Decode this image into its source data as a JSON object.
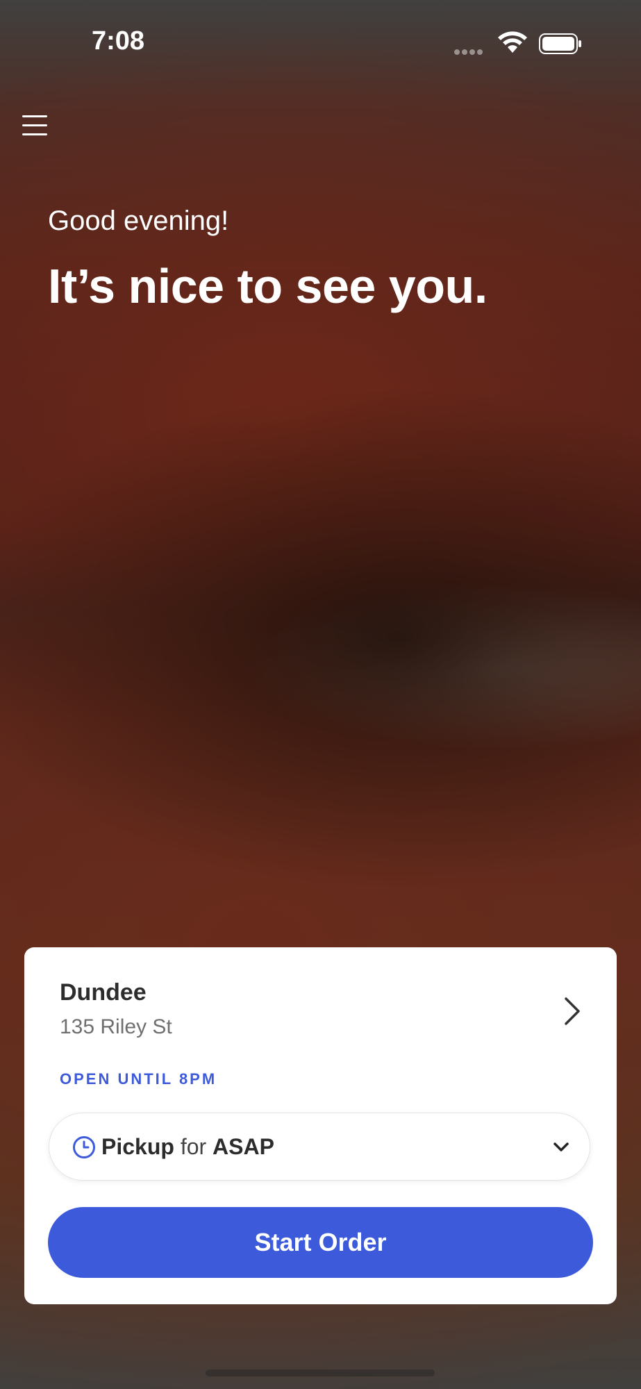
{
  "status_bar": {
    "time": "7:08"
  },
  "header": {
    "greeting": "Good evening!",
    "headline": "It’s nice to see you."
  },
  "store": {
    "name": "Dundee",
    "address": "135 Riley St",
    "hours": "OPEN UNTIL 8PM"
  },
  "order_options": {
    "mode": "Pickup",
    "connector": "for",
    "time": "ASAP"
  },
  "actions": {
    "start_order": "Start Order"
  },
  "colors": {
    "accent": "#3d5adb"
  },
  "icons": {
    "menu": "hamburger-menu-icon",
    "chevron": "chevron-right-icon",
    "clock": "clock-icon",
    "dropdown": "chevron-down-icon"
  }
}
